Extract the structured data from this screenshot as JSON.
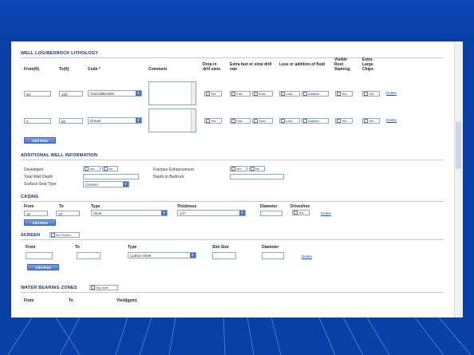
{
  "well_log": {
    "title": "WELL LOG/BEDROCK LITHOLOGY",
    "headers": {
      "from": "From(ft)",
      "to": "To(ft)",
      "code": "Code *",
      "comment": "Comment",
      "drop": "Drop in drill stem",
      "extra_fast": "Extra fast or slow drill rate",
      "loss": "Loss or addition of fluid",
      "visible": "Visible Rust Staining",
      "extra_large": "Extra Large Chips"
    },
    "rows": [
      {
        "from": "60",
        "to": "100",
        "code": "Glacial/Boulder",
        "yes": "Yes",
        "fast": "Fast",
        "slow": "Slow",
        "loss": "Loss",
        "addition": "Addition",
        "yes2": "Yes",
        "yes3": "Yes",
        "delete": "Delete"
      },
      {
        "from": "0",
        "to": "60",
        "code": "Gravel",
        "yes": "Yes",
        "fast": "Fast",
        "slow": "Slow",
        "loss": "Loss",
        "addition": "Addition",
        "yes2": "Yes",
        "yes3": "Yes",
        "delete": "Delete"
      }
    ],
    "add_button": "Add Row"
  },
  "additional": {
    "title": "ADDITIONAL WELL INFORMATION",
    "developed": "Developed",
    "total_well_depth": "Total Well Depth",
    "surface_seal_type": "Surface Seal Type",
    "seal_value": "Cement",
    "yes": "Yes",
    "no": "No",
    "fracture": "Fracture Enhancement",
    "depth_bedrock": "Depth to Bedrock"
  },
  "casing": {
    "title": "CASING",
    "headers": {
      "from": "From",
      "to": "To",
      "type": "Type",
      "thickness": "Thickness",
      "diameter": "Diameter",
      "drivesboe": "Driveshoe"
    },
    "row": {
      "from": "10",
      "to": "20",
      "type": "Steel",
      "thickness": "1/4\"",
      "yes": "Yes",
      "delete": "Delete"
    },
    "add_button": "Add Row"
  },
  "screen": {
    "title": "SCREEN",
    "no_screen": "No Screen",
    "headers": {
      "from": "From",
      "to": "To",
      "type": "Type",
      "slot": "Slot Size",
      "diameter": "Diameter"
    },
    "row": {
      "type": "Carbon Steel",
      "delete": "Delete"
    },
    "add_button": "Add Row"
  },
  "water": {
    "title": "WATER BEARING ZONES",
    "toggle": "Dry Hole",
    "headers": {
      "from": "From",
      "to": "To",
      "yield": "Yield(gpm)"
    }
  },
  "colors": {
    "frame": "#0a3fa6",
    "panel": "#ffffff",
    "accent": "#4d77cf"
  }
}
